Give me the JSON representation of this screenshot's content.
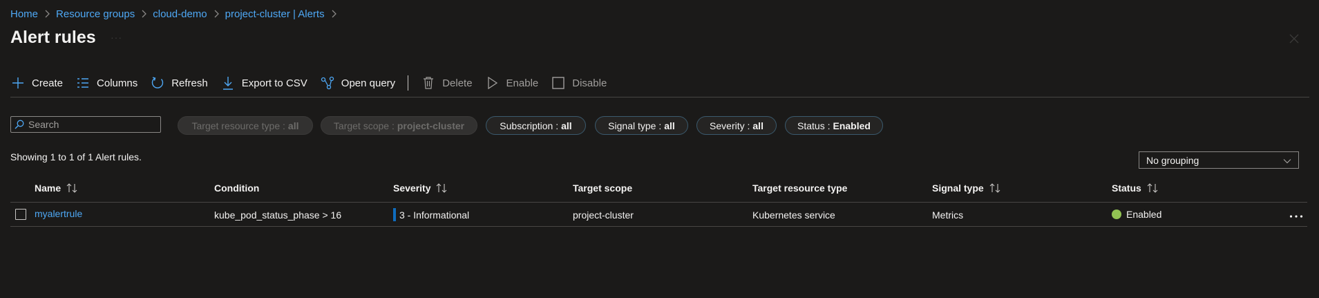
{
  "breadcrumb": [
    "Home",
    "Resource groups",
    "cloud-demo",
    "project-cluster | Alerts"
  ],
  "page": {
    "title": "Alert rules"
  },
  "toolbar": {
    "create": "Create",
    "columns": "Columns",
    "refresh": "Refresh",
    "export": "Export to CSV",
    "open_query": "Open query",
    "delete": "Delete",
    "enable": "Enable",
    "disable": "Disable"
  },
  "search": {
    "placeholder": "Search"
  },
  "filters": [
    {
      "label": "Target resource type :",
      "value": "all",
      "enabled": false
    },
    {
      "label": "Target scope :",
      "value": "project-cluster",
      "enabled": false
    },
    {
      "label": "Subscription :",
      "value": "all",
      "enabled": true
    },
    {
      "label": "Signal type :",
      "value": "all",
      "enabled": true
    },
    {
      "label": "Severity :",
      "value": "all",
      "enabled": true
    },
    {
      "label": "Status :",
      "value": "Enabled",
      "enabled": true
    }
  ],
  "summary": "Showing 1 to 1 of 1 Alert rules.",
  "grouping": {
    "selected": "No grouping"
  },
  "table": {
    "columns": [
      "Name",
      "Condition",
      "Severity",
      "Target scope",
      "Target resource type",
      "Signal type",
      "Status"
    ],
    "rows": [
      {
        "name": "myalertrule",
        "condition": "kube_pod_status_phase > 16",
        "severity": "3 - Informational",
        "target_scope": "project-cluster",
        "target_resource_type": "Kubernetes service",
        "signal_type": "Metrics",
        "status": "Enabled"
      }
    ]
  },
  "colors": {
    "background": "#1b1a19",
    "link": "#4ea8f5",
    "accent": "#0f6cbd",
    "status_enabled": "#92c353",
    "severity_informational": "#0f6cbd"
  },
  "icons": {
    "create": "plus-icon",
    "columns": "columns-icon",
    "refresh": "refresh-icon",
    "export": "download-icon",
    "open_query": "query-icon",
    "delete": "trash-icon",
    "enable": "play-icon",
    "disable": "square-icon",
    "search": "search-icon",
    "close": "close-icon",
    "grouping": "chevron-down-icon",
    "sort": "sort-icon",
    "row_actions": "more-icon"
  }
}
